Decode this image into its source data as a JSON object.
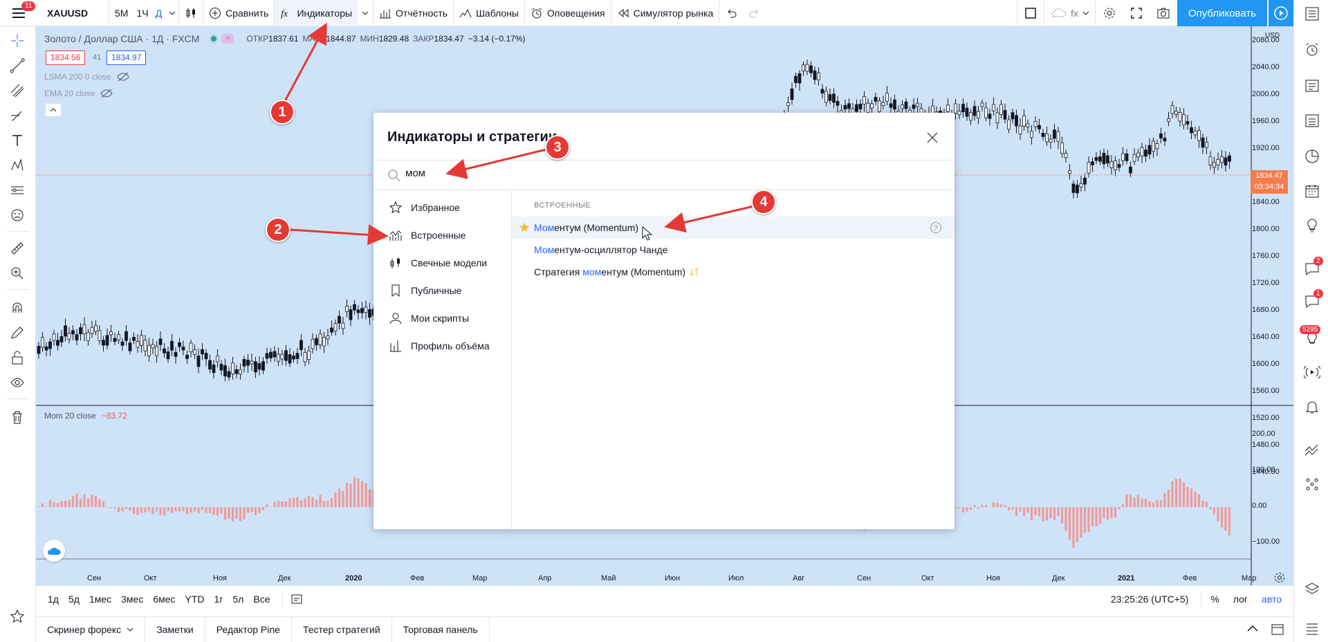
{
  "topbar": {
    "menu_badge": "11",
    "symbol": "XAUUSD",
    "intervals": [
      "5М",
      "1Ч",
      "Д"
    ],
    "compare": "Сравнить",
    "indicators": "Индикаторы",
    "reports": "Отчётность",
    "templates": "Шаблоны",
    "alerts": "Оповещения",
    "replay": "Симулятор рынка",
    "fx": "fx",
    "publish": "Опубликовать"
  },
  "legend": {
    "title": "Золото / Доллар США · 1Д · FXCM",
    "open_label": "ОТКР",
    "open": "1837.61",
    "high_label": "МАКС",
    "high": "1844.87",
    "low_label": "МИН",
    "low": "1829.48",
    "close_label": "ЗАКР",
    "close": "1834.47",
    "change": "−3.14 (−0.17%)",
    "bid": "1834.56",
    "spread": "41",
    "ask": "1834.97",
    "lsma": "LSMA 200 0 close",
    "ema": "EMA 20 close"
  },
  "momentum_pane": {
    "label": "Mom 20 close",
    "value": "−83.72"
  },
  "price_axis": {
    "currency": "USD",
    "ticks": [
      "2080.00",
      "2040.00",
      "2000.00",
      "1960.00",
      "1920.00",
      "1880.00",
      "1840.00",
      "1800.00",
      "1760.00",
      "1720.00",
      "1680.00",
      "1640.00",
      "1600.00",
      "1560.00",
      "1520.00",
      "1480.00",
      "1440.00"
    ],
    "last_price": "1834.47",
    "countdown": "03:34:34",
    "mom_ticks": [
      "200.00",
      "100.00",
      "0.00",
      "−100.00"
    ]
  },
  "time_axis": [
    "Сен",
    "Окт",
    "Ноя",
    "Дек",
    "2020",
    "Фев",
    "Мар",
    "Апр",
    "Май",
    "Июн",
    "Июл",
    "Авг",
    "Сен",
    "Окт",
    "Ноя",
    "Дек",
    "2021",
    "Фев",
    "Мар"
  ],
  "range_bar": {
    "ranges": [
      "1д",
      "5д",
      "1мес",
      "3мес",
      "6мес",
      "YTD",
      "1г",
      "5л",
      "Все"
    ],
    "clock": "23:25:26 (UTC+5)",
    "percent": "%",
    "log": "лог",
    "auto": "авто"
  },
  "bottom_tabs": [
    "Скринер форекс",
    "Заметки",
    "Редактор Pine",
    "Тестер стратегий",
    "Торговая панель"
  ],
  "right_badges": {
    "chat1": "2",
    "chat2": "1",
    "ideas": "5295"
  },
  "dialog": {
    "title": "Индикаторы и стратегии",
    "search_value": "мом",
    "nav": [
      "Избранное",
      "Встроенные",
      "Свечные модели",
      "Публичные",
      "Мои скрипты",
      "Профиль объёма"
    ],
    "section": "ВСТРОЕННЫЕ",
    "results": [
      {
        "pre": "",
        "hi": "Мом",
        "post": "ентум (Momentum)",
        "starred": true
      },
      {
        "pre": "",
        "hi": "Мом",
        "post": "ентум-осциллятор Чанде",
        "starred": false
      },
      {
        "pre": "Стратегия ",
        "hi": "мом",
        "post": "ентум (Momentum)",
        "starred": false
      }
    ]
  },
  "annotations": [
    "1",
    "2",
    "3",
    "4"
  ],
  "colors": {
    "accent": "#2962ff",
    "publish": "#2196f3",
    "chart_bg": "#cfe3f8",
    "candle": "#131722",
    "mom_bar": "#ef9a9a",
    "annotation": "#e53935",
    "price_label": "#f57c4c"
  }
}
